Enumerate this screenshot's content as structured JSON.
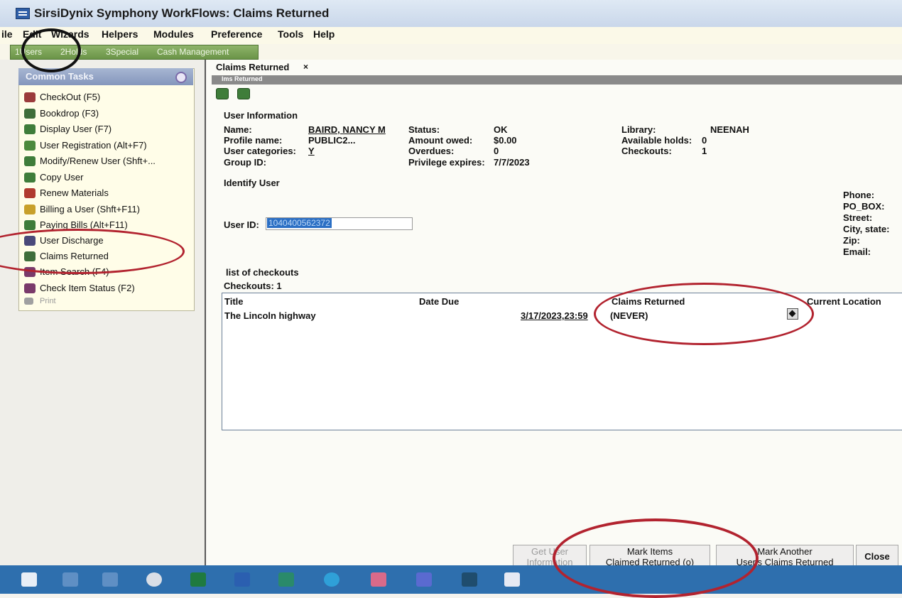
{
  "window": {
    "title": "SirsiDynix Symphony WorkFlows: Claims Returned"
  },
  "menu": [
    "ile",
    "Edit",
    "Wizards",
    "Helpers",
    "Modules",
    "Preference",
    "Tools",
    "Help"
  ],
  "group_tabs": [
    "1Users",
    "2Holds",
    "3Special",
    "Cash Management"
  ],
  "common_tasks": {
    "title": "Common Tasks",
    "items": [
      {
        "label": "CheckOut (F5)",
        "color": "#9b3b3b"
      },
      {
        "label": "Bookdrop (F3)",
        "color": "#3f6e3a"
      },
      {
        "label": "Display User (F7)",
        "color": "#3f7d3a"
      },
      {
        "label": "User Registration (Alt+F7)",
        "color": "#4c8a3c"
      },
      {
        "label": "Modify/Renew User (Shft+...",
        "color": "#3f7d3a"
      },
      {
        "label": "Copy User",
        "color": "#3f7d3a"
      },
      {
        "label": "Renew Materials",
        "color": "#b03a2e"
      },
      {
        "label": "Billing a User (Shft+F11)",
        "color": "#c8a02a"
      },
      {
        "label": "Paying Bills (Alt+F11)",
        "color": "#3f7d3a"
      },
      {
        "label": "User Discharge",
        "color": "#4a4a7a"
      },
      {
        "label": "Claims Returned",
        "color": "#3f6e3a"
      },
      {
        "label": "Item Search (F4)",
        "color": "#7a3a6a"
      },
      {
        "label": "Check Item Status (F2)",
        "color": "#7a3a6a"
      },
      {
        "label": "Print",
        "color": "#a0a0a0"
      }
    ]
  },
  "doc_tab": {
    "label": "Claims Returned",
    "close": "×"
  },
  "subbar": "Ims Returned",
  "user_info": {
    "heading": "User Information",
    "name_label": "Name:",
    "name": "BAIRD, NANCY M",
    "profile_label": "Profile name:",
    "profile": "PUBLIC2...",
    "categories_label": "User categories:",
    "categories": "Y",
    "group_label": "Group ID:",
    "status_label": "Status:",
    "status": "OK",
    "owed_label": "Amount owed:",
    "owed": "$0.00",
    "overdues_label": "Overdues:",
    "overdues": "0",
    "privilege_label": "Privilege expires:",
    "privilege": "7/7/2023",
    "library_label": "Library:",
    "library": "NEENAH",
    "holds_label": "Available holds:",
    "holds": "0",
    "checkouts_label": "Checkouts:",
    "checkouts": "1"
  },
  "identify": {
    "heading": "Identify User",
    "userid_label": "User ID:",
    "userid": "1040400562372"
  },
  "contact_labels": [
    "Phone:",
    "PO_BOX:",
    "Street:",
    "City, state:",
    "Zip:",
    "Email:"
  ],
  "checkouts": {
    "heading": "list of checkouts",
    "count_label": "Checkouts: 1",
    "columns": [
      "Title",
      "Date Due",
      "Claims Returned",
      "Current Location"
    ],
    "rows": [
      {
        "title": "The Lincoln highway",
        "date_due": "3/17/2023,23:59",
        "claims": "(NEVER)"
      }
    ]
  },
  "buttons": {
    "get_info": [
      "Get User",
      "Information"
    ],
    "mark_items": [
      "Mark Items",
      "Claimed Returned (o)"
    ],
    "mark_another": [
      "Mark Another",
      "User's Claims Returned"
    ],
    "close": "Close"
  },
  "taskbar_icons": [
    "start-icon",
    "search-icon",
    "task-view-icon",
    "settings-icon",
    "excel-icon",
    "word-icon",
    "publisher-icon",
    "edge-icon",
    "paint-icon",
    "teams-icon",
    "phone-icon",
    "workflows-icon"
  ]
}
